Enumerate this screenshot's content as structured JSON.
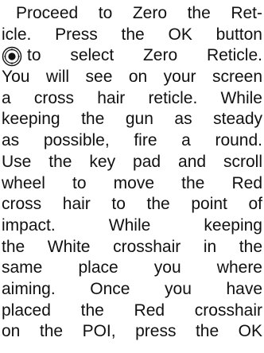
{
  "paragraph": {
    "lines": [
      "Proceed to Zero the Ret-",
      "icle. Press the OK button",
      "to select Zero Reticle.",
      "You will see on your screen",
      "a cross hair reticle. While",
      "keeping the gun as steady",
      "as possible, fire a round.",
      "Use the key pad and scroll",
      "wheel to move the Red",
      "cross hair to the point of",
      "impact. While keeping",
      "the White crosshair in the",
      "same place you where",
      "aiming. Once you have",
      "placed the Red crosshair",
      "on the POI, press the OK"
    ]
  },
  "icons": {
    "ok_button": "ok-button-icon"
  }
}
